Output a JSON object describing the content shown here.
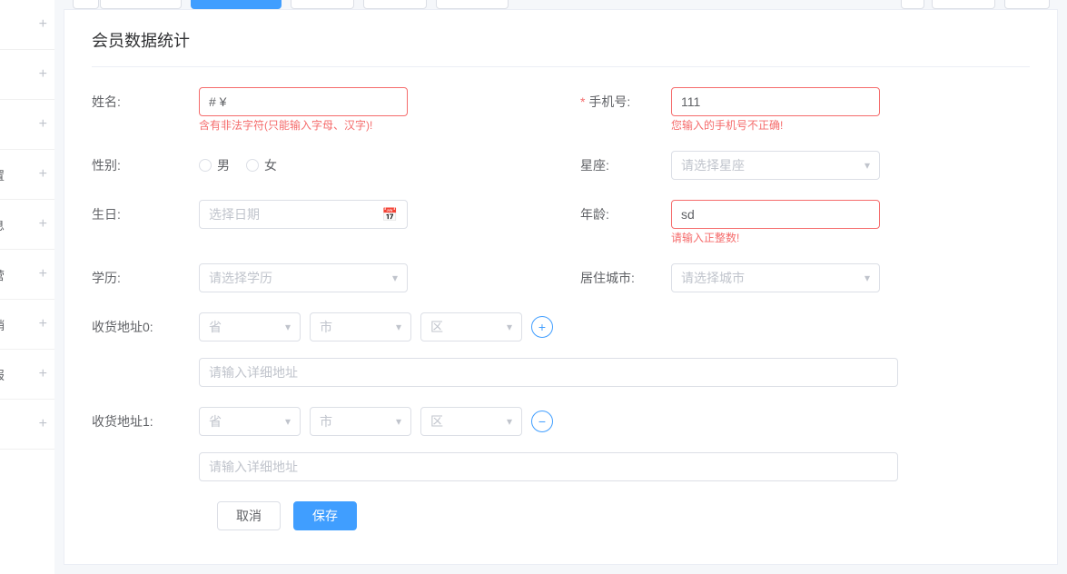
{
  "panel": {
    "title": "会员数据统计"
  },
  "form": {
    "name": {
      "label": "姓名:",
      "value": "# ¥",
      "error": "含有非法字符(只能输入字母、汉字)!"
    },
    "phone": {
      "label": "手机号:",
      "value": "111",
      "error": "您输入的手机号不正确!"
    },
    "gender": {
      "label": "性别:",
      "options": {
        "male": "男",
        "female": "女"
      }
    },
    "constellation": {
      "label": "星座:",
      "placeholder": "请选择星座"
    },
    "birthday": {
      "label": "生日:",
      "placeholder": "选择日期"
    },
    "age": {
      "label": "年龄:",
      "value": "sd",
      "error": "请输入正整数!"
    },
    "education": {
      "label": "学历:",
      "placeholder": "请选择学历"
    },
    "city": {
      "label": "居住城市:",
      "placeholder": "请选择城市"
    },
    "address0": {
      "label": "收货地址0:",
      "province": "省",
      "city": "市",
      "district": "区",
      "detail_placeholder": "请输入详细地址"
    },
    "address1": {
      "label": "收货地址1:",
      "province": "省",
      "city": "市",
      "district": "区",
      "detail_placeholder": "请输入详细地址"
    },
    "buttons": {
      "cancel": "取消",
      "save": "保存"
    }
  }
}
